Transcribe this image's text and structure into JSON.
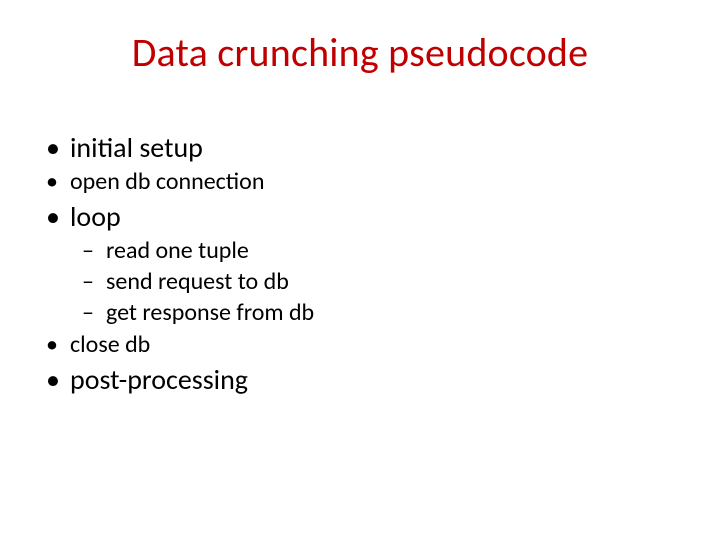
{
  "title": "Data crunching pseudocode",
  "items": {
    "initial_setup": "initial setup",
    "open_db": "open db connection",
    "loop": "loop",
    "read_tuple": "read one tuple",
    "send_request": "send request to db",
    "get_response": "get response from db",
    "close_db": "close db",
    "post_processing": "post-processing"
  }
}
